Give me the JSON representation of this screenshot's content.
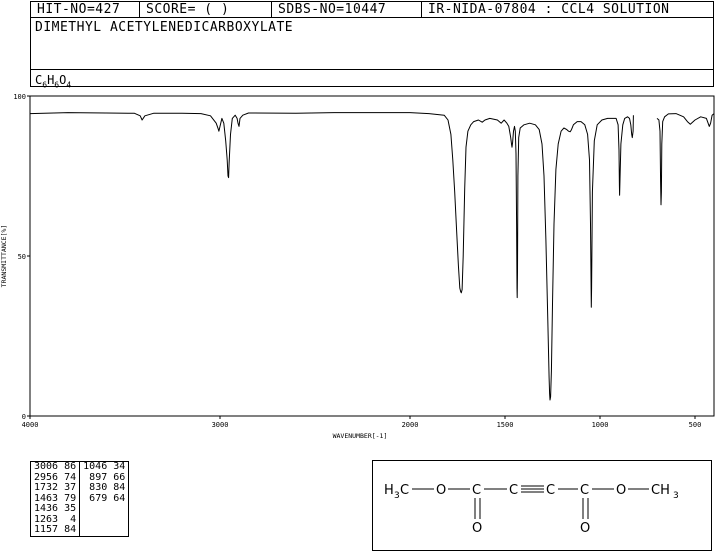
{
  "header": {
    "hit_no": "HIT-NO=427",
    "score": "SCORE=  (   )",
    "sdbs_no": "SDBS-NO=10447",
    "ir_info": "IR-NIDA-07804 : CCL4 SOLUTION"
  },
  "compound": {
    "name": "DIMETHYL ACETYLENEDICARBOXYLATE",
    "formula_parts": [
      "C",
      "6",
      "H",
      "6",
      "O",
      "4"
    ]
  },
  "chart_data": {
    "type": "line",
    "xlabel": "WAVENUMBER[-1]",
    "ylabel": "TRANSMITTANCE[%]",
    "xlim": [
      4000,
      400
    ],
    "ylim": [
      0,
      100
    ],
    "x_ticks": [
      4000,
      3000,
      2000,
      1500,
      1000,
      500
    ],
    "y_ticks": [
      0,
      50,
      100
    ],
    "series": [
      {
        "segments": [
          [
            [
              4000,
              94.5
            ],
            [
              3800,
              94.8
            ],
            [
              3600,
              94.7
            ],
            [
              3450,
              94.6
            ],
            [
              3420,
              93.8
            ],
            [
              3410,
              92.5
            ],
            [
              3395,
              93.8
            ],
            [
              3350,
              94.6
            ],
            [
              3200,
              94.6
            ],
            [
              3100,
              94.5
            ],
            [
              3050,
              93.8
            ],
            [
              3020,
              91.5
            ],
            [
              3010,
              89.8
            ],
            [
              3006,
              89
            ],
            [
              3000,
              90.5
            ],
            [
              2990,
              93
            ],
            [
              2980,
              91.5
            ],
            [
              2970,
              86
            ],
            [
              2962,
              80
            ],
            [
              2958,
              75
            ],
            [
              2955,
              74.5
            ],
            [
              2952,
              79
            ],
            [
              2945,
              88
            ],
            [
              2935,
              93
            ],
            [
              2920,
              94
            ],
            [
              2910,
              93
            ],
            [
              2905,
              91.5
            ],
            [
              2900,
              90.5
            ],
            [
              2895,
              93
            ],
            [
              2880,
              94
            ],
            [
              2850,
              94.7
            ],
            [
              2600,
              94.6
            ],
            [
              2400,
              94.8
            ],
            [
              2200,
              94.8
            ],
            [
              2000,
              94.8
            ],
            [
              1900,
              94.5
            ],
            [
              1820,
              94
            ],
            [
              1800,
              92.5
            ],
            [
              1785,
              88
            ],
            [
              1775,
              80
            ],
            [
              1765,
              70
            ],
            [
              1755,
              58
            ],
            [
              1745,
              47
            ],
            [
              1738,
              40
            ],
            [
              1733,
              38.8
            ],
            [
              1730,
              38.5
            ],
            [
              1726,
              39.5
            ],
            [
              1720,
              50
            ],
            [
              1712,
              71
            ],
            [
              1705,
              84
            ],
            [
              1695,
              89
            ],
            [
              1680,
              91
            ],
            [
              1665,
              92
            ],
            [
              1640,
              92.5
            ],
            [
              1620,
              91.8
            ],
            [
              1605,
              92.5
            ],
            [
              1580,
              93
            ],
            [
              1540,
              92.5
            ],
            [
              1520,
              91.5
            ],
            [
              1505,
              92.5
            ],
            [
              1490,
              91.5
            ],
            [
              1480,
              90.5
            ],
            [
              1470,
              87
            ],
            [
              1466,
              85
            ],
            [
              1463,
              84
            ],
            [
              1460,
              85.5
            ],
            [
              1455,
              89
            ],
            [
              1450,
              90.5
            ],
            [
              1446,
              89
            ],
            [
              1442,
              82
            ],
            [
              1439,
              60
            ],
            [
              1437,
              40
            ],
            [
              1436,
              37
            ],
            [
              1434,
              45
            ],
            [
              1432,
              75
            ],
            [
              1428,
              87
            ],
            [
              1420,
              90
            ],
            [
              1400,
              91
            ],
            [
              1370,
              91.5
            ],
            [
              1340,
              91
            ],
            [
              1320,
              89.5
            ],
            [
              1305,
              85
            ],
            [
              1295,
              75
            ],
            [
              1285,
              55
            ],
            [
              1275,
              30
            ],
            [
              1268,
              12
            ],
            [
              1265,
              7
            ],
            [
              1263,
              5
            ],
            [
              1260,
              6
            ],
            [
              1256,
              14
            ],
            [
              1250,
              35
            ],
            [
              1242,
              60
            ],
            [
              1232,
              77
            ],
            [
              1220,
              85
            ],
            [
              1205,
              89
            ],
            [
              1190,
              90
            ],
            [
              1175,
              89.5
            ],
            [
              1165,
              89
            ],
            [
              1157,
              88.8
            ],
            [
              1150,
              89.5
            ],
            [
              1140,
              91
            ],
            [
              1120,
              92
            ],
            [
              1100,
              92
            ],
            [
              1080,
              91
            ],
            [
              1065,
              88
            ],
            [
              1055,
              80
            ],
            [
              1050,
              60
            ],
            [
              1047,
              40
            ],
            [
              1046,
              34
            ],
            [
              1044,
              40
            ],
            [
              1040,
              70
            ],
            [
              1030,
              86
            ],
            [
              1015,
              91
            ],
            [
              990,
              92.5
            ],
            [
              960,
              93
            ],
            [
              930,
              93
            ],
            [
              915,
              93
            ],
            [
              905,
              91
            ],
            [
              900,
              83
            ],
            [
              898,
              72
            ],
            [
              897,
              69
            ],
            [
              895,
              74
            ],
            [
              890,
              85
            ],
            [
              880,
              91
            ],
            [
              870,
              93
            ],
            [
              855,
              93.5
            ],
            [
              845,
              93
            ],
            [
              838,
              91
            ],
            [
              833,
              88
            ],
            [
              830,
              87
            ],
            [
              826,
              89
            ],
            [
              824,
              94
            ]
          ],
          [
            [
              700,
              93
            ],
            [
              690,
              92.5
            ],
            [
              684,
              89
            ],
            [
              681,
              73
            ],
            [
              679,
              66
            ],
            [
              677,
              70
            ],
            [
              675,
              85
            ],
            [
              670,
              92
            ],
            [
              660,
              93.5
            ],
            [
              640,
              94.4
            ],
            [
              600,
              94.5
            ],
            [
              560,
              93.5
            ],
            [
              540,
              92
            ],
            [
              525,
              91.2
            ],
            [
              515,
              91.7
            ],
            [
              500,
              92.5
            ],
            [
              470,
              93.5
            ],
            [
              440,
              93
            ],
            [
              425,
              90.5
            ],
            [
              418,
              91.5
            ],
            [
              410,
              94
            ],
            [
              400,
              94.5
            ]
          ]
        ]
      }
    ],
    "peak_table": [
      [
        "3006",
        "86",
        "1046",
        "34"
      ],
      [
        "2956",
        "74",
        "897",
        "66"
      ],
      [
        "1732",
        "37",
        "830",
        "84"
      ],
      [
        "1463",
        "79",
        "679",
        "64"
      ],
      [
        "1436",
        "35",
        "",
        ""
      ],
      [
        "1263",
        "4",
        "",
        ""
      ],
      [
        "1157",
        "84",
        "",
        ""
      ]
    ]
  },
  "structure": {
    "atoms": {
      "left_methyl_h": "H",
      "left_methyl_sub": "3",
      "left_methyl_c": "C",
      "o1": "O",
      "c1": "C",
      "c2": "C",
      "c3": "C",
      "c4": "C",
      "o2": "O",
      "right_methyl": "CH",
      "right_methyl_sub": "3",
      "o_left": "O",
      "o_right": "O"
    }
  }
}
